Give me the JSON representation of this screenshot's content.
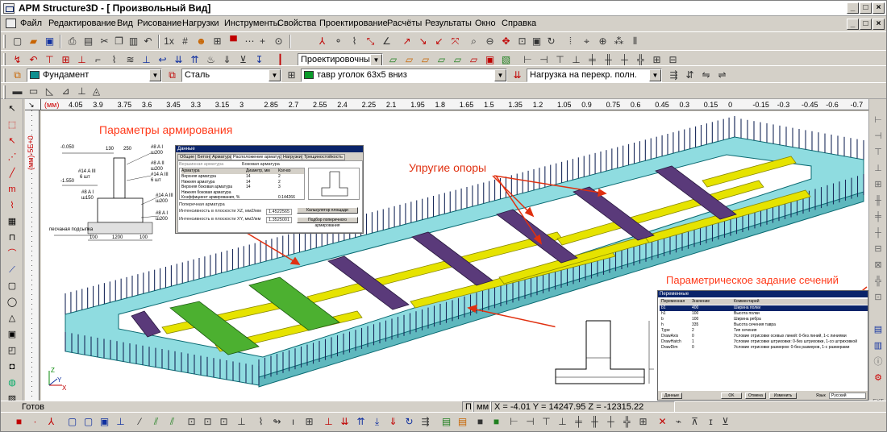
{
  "window": {
    "title": "APM Structure3D - [ Произвольный Вид]",
    "controls": [
      "_",
      "□",
      "×"
    ],
    "doc_controls": [
      "_",
      "□",
      "×"
    ]
  },
  "menu": [
    "Файл",
    "Редактирование",
    "Вид",
    "Рисование",
    "Нагрузки",
    "Инструменты",
    "Свойства",
    "Проектирование",
    "Расчёты",
    "Результаты",
    "Окно",
    "Справка"
  ],
  "toolbar2": {
    "mode_combo": "Проектировочный"
  },
  "toolbar3": {
    "material_group": "Фундамент",
    "material": "Сталь",
    "section": "тавр уголок 63х5 вниз",
    "load_case": "Нагрузка на перекр. полн.",
    "colors": {
      "group_swatch": "#0e8f8f",
      "section_swatch": "#0a9a2a"
    }
  },
  "ruler": {
    "unit": "(мм)",
    "ticks": [
      "4.05",
      "3.9",
      "3.75",
      "3.6",
      "3.45",
      "3.3",
      "3.15",
      "3",
      "2.85",
      "2.7",
      "2.55",
      "2.4",
      "2.25",
      "2.1",
      "1.95",
      "1.8",
      "1.65",
      "1.5",
      "1.35",
      "1.2",
      "1.05",
      "0.9",
      "0.75",
      "0.6",
      "0.45",
      "0.3",
      "0.15",
      "0",
      "-0.15",
      "-0.3",
      "-0.45",
      "-0.6",
      "-0.7"
    ],
    "vertical_label": "(мм)-5E+0"
  },
  "annotations": {
    "reinforcement": "Параметры армирования",
    "supports": "Упругие опоры",
    "sections": "Параметрическое задание сечений"
  },
  "drawing": {
    "labels": [
      "-0.050",
      "-1.550",
      "130",
      "250",
      "#8 A I",
      "ш200",
      "#8 A II",
      "ш200",
      "#14 A III",
      "6 шт",
      "#14 A III",
      "6 шт",
      "#8 A I",
      "ш150",
      "#14 A III",
      "ш200",
      "#8 A I",
      "ш200",
      "песчаная подсыпка",
      "100",
      "1200",
      "100"
    ]
  },
  "reinf_dialog": {
    "title": "Данные",
    "tabs": [
      "Общие",
      "Бетон",
      "Арматура",
      "Расположение арматуры",
      "Нагрузки",
      "Трещиностойкость"
    ],
    "checks": [
      "Вершинная арматура",
      "Боковая арматура"
    ],
    "columns": [
      "Арматура",
      "Диаметр, мм",
      "Кол-во"
    ],
    "rows": [
      {
        "name": "Верхняя арматура",
        "d": "14",
        "n": "2"
      },
      {
        "name": "Нижняя арматура",
        "d": "14",
        "n": "2"
      },
      {
        "name": "Верхняя боковая арматура",
        "d": "14",
        "n": "3"
      },
      {
        "name": "Нижняя боковая арматура",
        "d": "",
        "n": ""
      },
      {
        "name": "Коэффициент армирования, %",
        "d": "",
        "n": "0.144266"
      }
    ],
    "section_label": "Поперечная арматура",
    "lines": [
      {
        "label": "Интенсивность в плоскости XZ, мм2/мм",
        "value": "1.4522565"
      },
      {
        "label": "Интенсивность в плоскости XY, мм2/мм",
        "value": "1.3525001"
      }
    ],
    "buttons": [
      "Калькулятор площади",
      "Подбор поперечного армирования"
    ]
  },
  "section_dialog": {
    "title": "Переменные",
    "columns": [
      "Переменная",
      "Значение",
      "Комментарий"
    ],
    "rows": [
      {
        "var": "b1",
        "val": "400",
        "comment": "Ширина полки"
      },
      {
        "var": "h1",
        "val": "100",
        "comment": "Высота полки"
      },
      {
        "var": "b",
        "val": "100",
        "comment": "Ширина ребра"
      },
      {
        "var": "h",
        "val": "335",
        "comment": "Высота сечения тавра"
      },
      {
        "var": "Type",
        "val": "2",
        "comment": "Тип сечения"
      },
      {
        "var": "DrawAxis",
        "val": "0",
        "comment": "Условие отрисовки осевых линий: 0-без линий, 1-с линиями"
      },
      {
        "var": "DrawHatch",
        "val": "1",
        "comment": "Условие отрисовки штриховки: 0-без штриховки, 1-со штриховкой"
      },
      {
        "var": "DrawDim",
        "val": "0",
        "comment": "Условие отрисовки размеров: 0-без размеров, 1-с размерами"
      }
    ],
    "buttons": [
      "Данные",
      "OK",
      "Отмена",
      "Изменить"
    ],
    "lang_label": "Язык",
    "lang_value": "Русский"
  },
  "status": {
    "ready": "Готов",
    "p": "П",
    "units": "мм",
    "coords": "X = -4.01  Y = 14247.95  Z = -12315.22"
  },
  "rightbar_label": "EXT"
}
